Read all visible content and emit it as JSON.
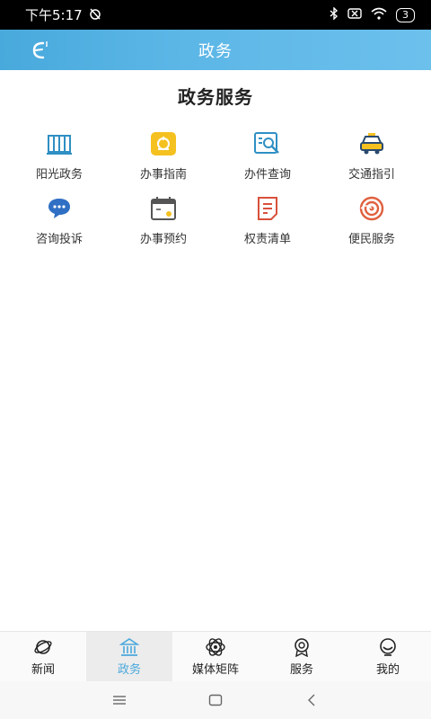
{
  "status_bar": {
    "time": "下午5:17",
    "battery": "3",
    "icons": [
      "alarm-off-icon",
      "bluetooth-icon",
      "sim-icon",
      "wifi-icon",
      "battery-icon"
    ]
  },
  "header": {
    "title": "政务"
  },
  "section": {
    "title": "政务服务"
  },
  "services": [
    {
      "label": "阳光政务",
      "icon": "building-icon"
    },
    {
      "label": "办事指南",
      "icon": "guide-icon"
    },
    {
      "label": "办件查询",
      "icon": "search-doc-icon"
    },
    {
      "label": "交通指引",
      "icon": "taxi-icon"
    },
    {
      "label": "咨询投诉",
      "icon": "chat-icon"
    },
    {
      "label": "办事预约",
      "icon": "calendar-icon"
    },
    {
      "label": "权责清单",
      "icon": "list-doc-icon"
    },
    {
      "label": "便民服务",
      "icon": "swirl-icon"
    }
  ],
  "bottom_nav": [
    {
      "label": "新闻",
      "icon": "planet-icon"
    },
    {
      "label": "政务",
      "icon": "government-icon",
      "active": true
    },
    {
      "label": "媒体矩阵",
      "icon": "atom-icon"
    },
    {
      "label": "服务",
      "icon": "badge-icon"
    },
    {
      "label": "我的",
      "icon": "profile-icon"
    }
  ],
  "colors": {
    "header_start": "#48a9dc",
    "header_end": "#6cc0ec",
    "active": "#4aa8dc"
  }
}
